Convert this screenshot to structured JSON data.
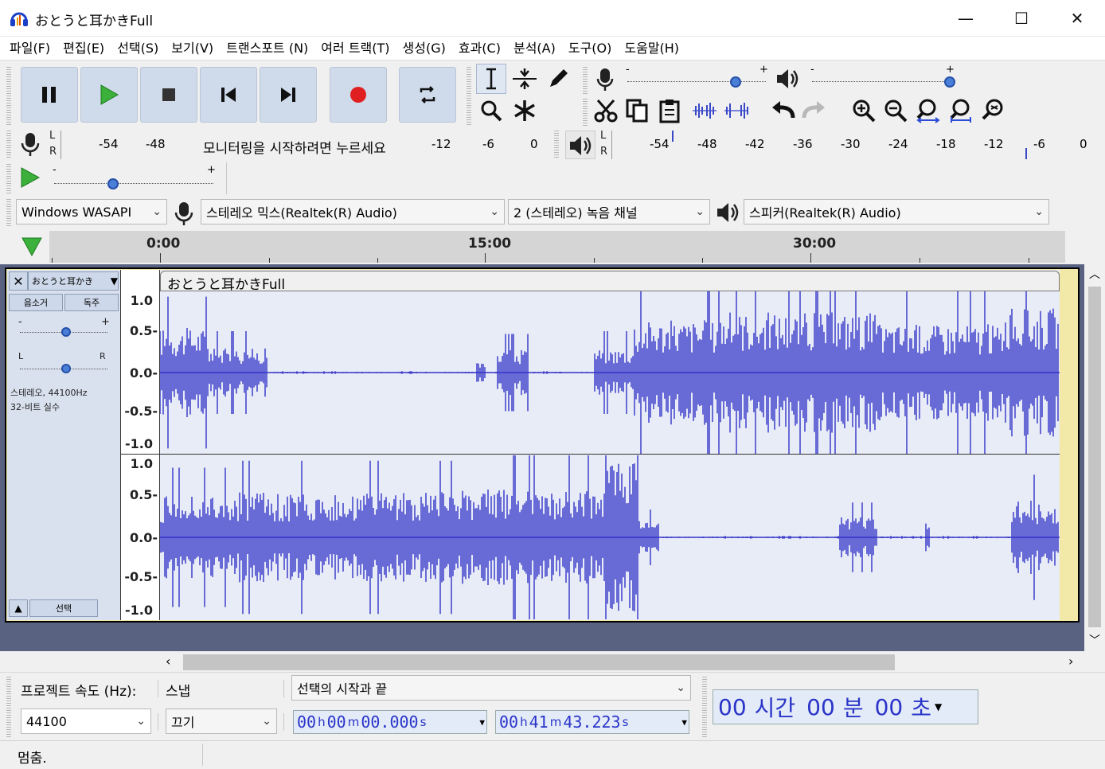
{
  "window": {
    "title": "おとうと耳かきFull",
    "minimize": "—",
    "maximize": "☐",
    "close": "✕"
  },
  "menu": [
    "파일(F)",
    "편집(E)",
    "선택(S)",
    "보기(V)",
    "트랜스포트 (N)",
    "여러 트랙(T)",
    "생성(G)",
    "효과(C)",
    "분석(A)",
    "도구(O)",
    "도움말(H)"
  ],
  "colors": {
    "accent": "#2a34c8",
    "waveform": "#3232c8",
    "record": "#e02020",
    "play": "#2ea12e",
    "selection": "#f2e8a8",
    "track_bg": "#596281"
  },
  "meters": {
    "lr_l": "L",
    "lr_r": "R",
    "record_ticks": [
      "-54",
      "-48",
      "-12",
      "-6",
      "0"
    ],
    "record_hint": "모니터링을 시작하려면 누르세요",
    "playback_ticks": [
      "-54",
      "-48",
      "-42",
      "-36",
      "-30",
      "-24",
      "-18",
      "-12",
      "-6",
      "0"
    ]
  },
  "sliders": {
    "minus": "-",
    "plus": "+",
    "record_volume": 0.74,
    "play_volume": 1.0,
    "play_speed": 0.35
  },
  "devices": {
    "host": "Windows WASAPI",
    "input": "스테레오 믹스(Realtek(R) Audio)",
    "channels": "2 (스테레오) 녹음 채널",
    "output": "스피커(Realtek(R) Audio)"
  },
  "timeline": {
    "labels": [
      "0:00",
      "15:00",
      "30:00"
    ]
  },
  "track": {
    "name": "おとうと耳かき",
    "clip_name": "おとうと耳かきFull",
    "mute": "음소거",
    "solo": "독주",
    "gain_minus": "-",
    "gain_plus": "+",
    "pan_l": "L",
    "pan_r": "R",
    "info_line1": "스테레오, 44100Hz",
    "info_line2": "32-비트 실수",
    "select": "선택",
    "gain": 0.5,
    "pan": 0.5,
    "scale": [
      "1.0",
      "0.5-",
      "0.0-",
      "-0.5-",
      "-1.0"
    ]
  },
  "selection_bar": {
    "rate_label": "프로젝트 속도 (Hz):",
    "rate_value": "44100",
    "snap_label": "스냅",
    "snap_value": "끄기",
    "sel_mode": "선택의 시작과 끝",
    "start": {
      "h": "00",
      "m": "00",
      "s": "00.000"
    },
    "end": {
      "h": "00",
      "m": "41",
      "s": "43.223"
    },
    "units": {
      "h": "h",
      "m": "m",
      "s": "s"
    },
    "big_time": {
      "h": "00",
      "h_unit": "시간",
      "m": "00",
      "m_unit": "분",
      "s": "00",
      "s_unit": "초"
    }
  },
  "status": "멈춤."
}
